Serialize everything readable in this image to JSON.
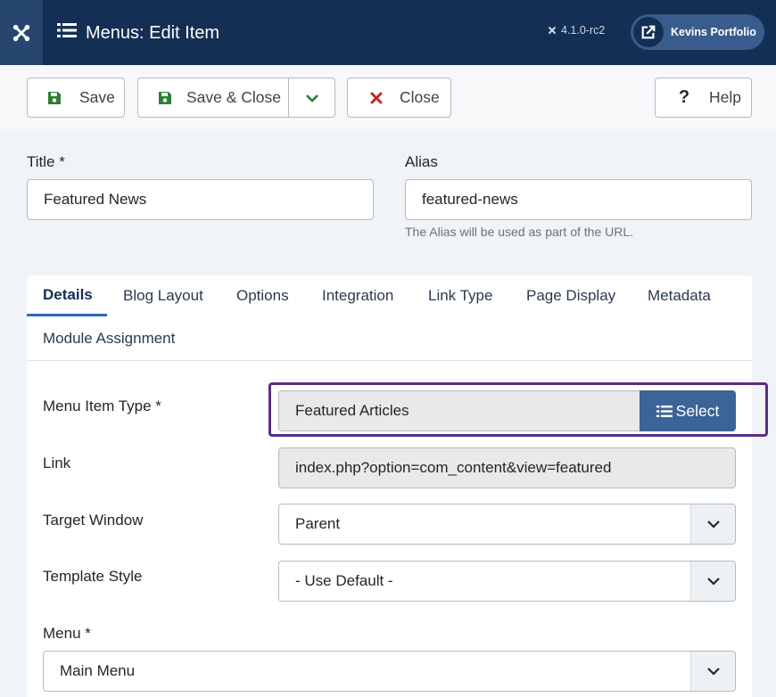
{
  "header": {
    "title": "Menus: Edit Item",
    "version": "4.1.0-rc2",
    "site_button": "Kevins Portfolio",
    "colors": {
      "bar": "#132f53",
      "logo_bg": "#26466f"
    },
    "icons": {
      "logo": "joomla-logo-icon",
      "title": "list-icon",
      "version": "joomla-small-icon",
      "site": "external-link-icon"
    }
  },
  "toolbar": {
    "save": "Save",
    "save_close": "Save & Close",
    "close": "Close",
    "help": "Help",
    "icons": {
      "save": "save-icon",
      "save_close": "save-icon",
      "dropdown": "chevron-down-icon",
      "close": "close-icon",
      "help": "question-icon"
    }
  },
  "form": {
    "title_label": "Title *",
    "title_value": "Featured News",
    "alias_label": "Alias",
    "alias_value": "featured-news",
    "alias_hint": "The Alias will be used as part of the URL."
  },
  "tabs": [
    {
      "label": "Details",
      "active": true
    },
    {
      "label": "Blog Layout",
      "active": false
    },
    {
      "label": "Options",
      "active": false
    },
    {
      "label": "Integration",
      "active": false
    },
    {
      "label": "Link Type",
      "active": false
    },
    {
      "label": "Page Display",
      "active": false
    },
    {
      "label": "Metadata",
      "active": false
    },
    {
      "label": "Module Assignment",
      "active": false
    }
  ],
  "details": {
    "menu_item_type_label": "Menu Item Type *",
    "menu_item_type_value": "Featured Articles",
    "select_label": "Select",
    "link_label": "Link",
    "link_value": "index.php?option=com_content&view=featured",
    "target_window_label": "Target Window",
    "target_window_value": "Parent",
    "template_style_label": "Template Style",
    "template_style_value": "- Use Default -",
    "menu_label": "Menu *",
    "menu_value": "Main Menu"
  },
  "accent": {
    "highlight": "#5c2d84",
    "select_button": "#3c6496",
    "tab_underline": "#2a69b8",
    "save_green": "#2f7d32",
    "close_red": "#c52827"
  }
}
